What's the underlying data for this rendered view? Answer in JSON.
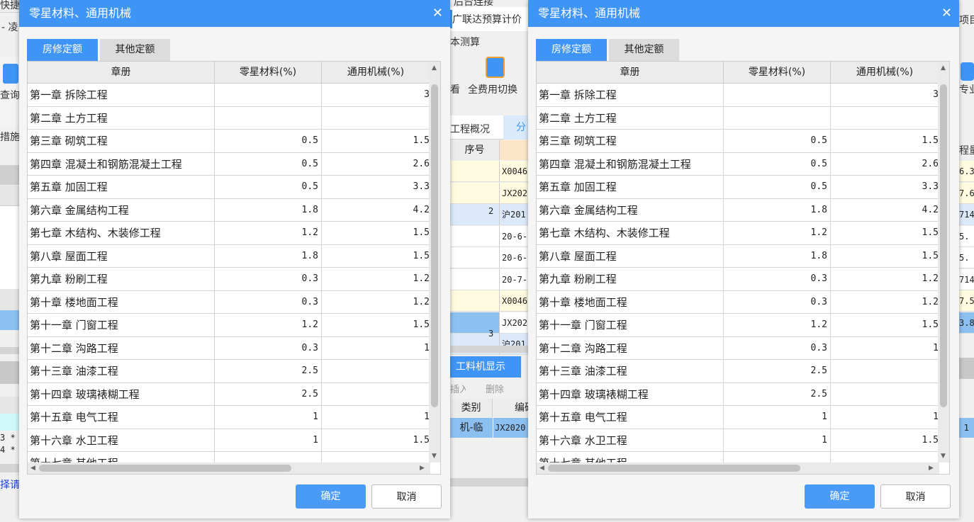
{
  "background": {
    "left": {
      "shortcut": "快捷",
      "title_frag": "- 凌",
      "query": "查询",
      "measures": "措施项",
      "r1": "3 *",
      "r2": "4 *",
      "link": "择请"
    },
    "middle": {
      "top_frag": "后台连接",
      "app": "广联达预算计价",
      "cost": "本测算",
      "view": "看",
      "switch": "全费用切换",
      "tab_overview": "工程概况",
      "tab_frag": "分",
      "col_seq": "序号",
      "codes": [
        "X0046",
        "JX202",
        "沪201",
        "20-6-",
        "20-6-",
        "20-7-",
        "X0046",
        "JX202",
        "沪201"
      ],
      "seq2": "2",
      "seq3": "3",
      "lab_tab": "工料机显示",
      "insert": "插入",
      "delete": "删除",
      "col_type": "类别",
      "col_code": "编码",
      "type_val": "机-临",
      "code_val": "JX2020"
    },
    "right": {
      "project": "项目",
      "major": "专业",
      "qty": "程量",
      "vals": [
        "6.3",
        "7.6",
        "714",
        "5.",
        "5.",
        "714",
        "7.5",
        "3.8"
      ],
      "bottom_val": "1"
    }
  },
  "dialog": {
    "title": "零星材料、通用机械",
    "close": "✕",
    "tabs": [
      "房修定额",
      "其他定额"
    ],
    "active_tab": 0,
    "columns": [
      "章册",
      "零星材料(%)",
      "通用机械(%)"
    ],
    "rows": [
      [
        "第一章 拆除工程",
        "",
        "3"
      ],
      [
        "第二章 土方工程",
        "",
        ""
      ],
      [
        "第三章 砌筑工程",
        "0.5",
        "1.5"
      ],
      [
        "第四章 混凝土和钢筋混凝土工程",
        "0.5",
        "2.6"
      ],
      [
        "第五章 加固工程",
        "0.5",
        "3.3"
      ],
      [
        "第六章 金属结构工程",
        "1.8",
        "4.2"
      ],
      [
        "第七章 木结构、木装修工程",
        "1.2",
        "1.5"
      ],
      [
        "第八章 屋面工程",
        "1.8",
        "1.5"
      ],
      [
        "第九章 粉刷工程",
        "0.3",
        "1.2"
      ],
      [
        "第十章 楼地面工程",
        "0.3",
        "1.2"
      ],
      [
        "第十一章 门窗工程",
        "1.2",
        "1.5"
      ],
      [
        "第十二章 沟路工程",
        "0.3",
        "1"
      ],
      [
        "第十三章 油漆工程",
        "2.5",
        ""
      ],
      [
        "第十四章 玻璃裱糊工程",
        "2.5",
        ""
      ],
      [
        "第十五章 电气工程",
        "1",
        "1"
      ],
      [
        "第十六章 水卫工程",
        "1",
        "1.5"
      ],
      [
        "第十七章 其他工程",
        "",
        ""
      ]
    ],
    "ok": "确定",
    "cancel": "取消",
    "accent": "#3f95f6"
  }
}
